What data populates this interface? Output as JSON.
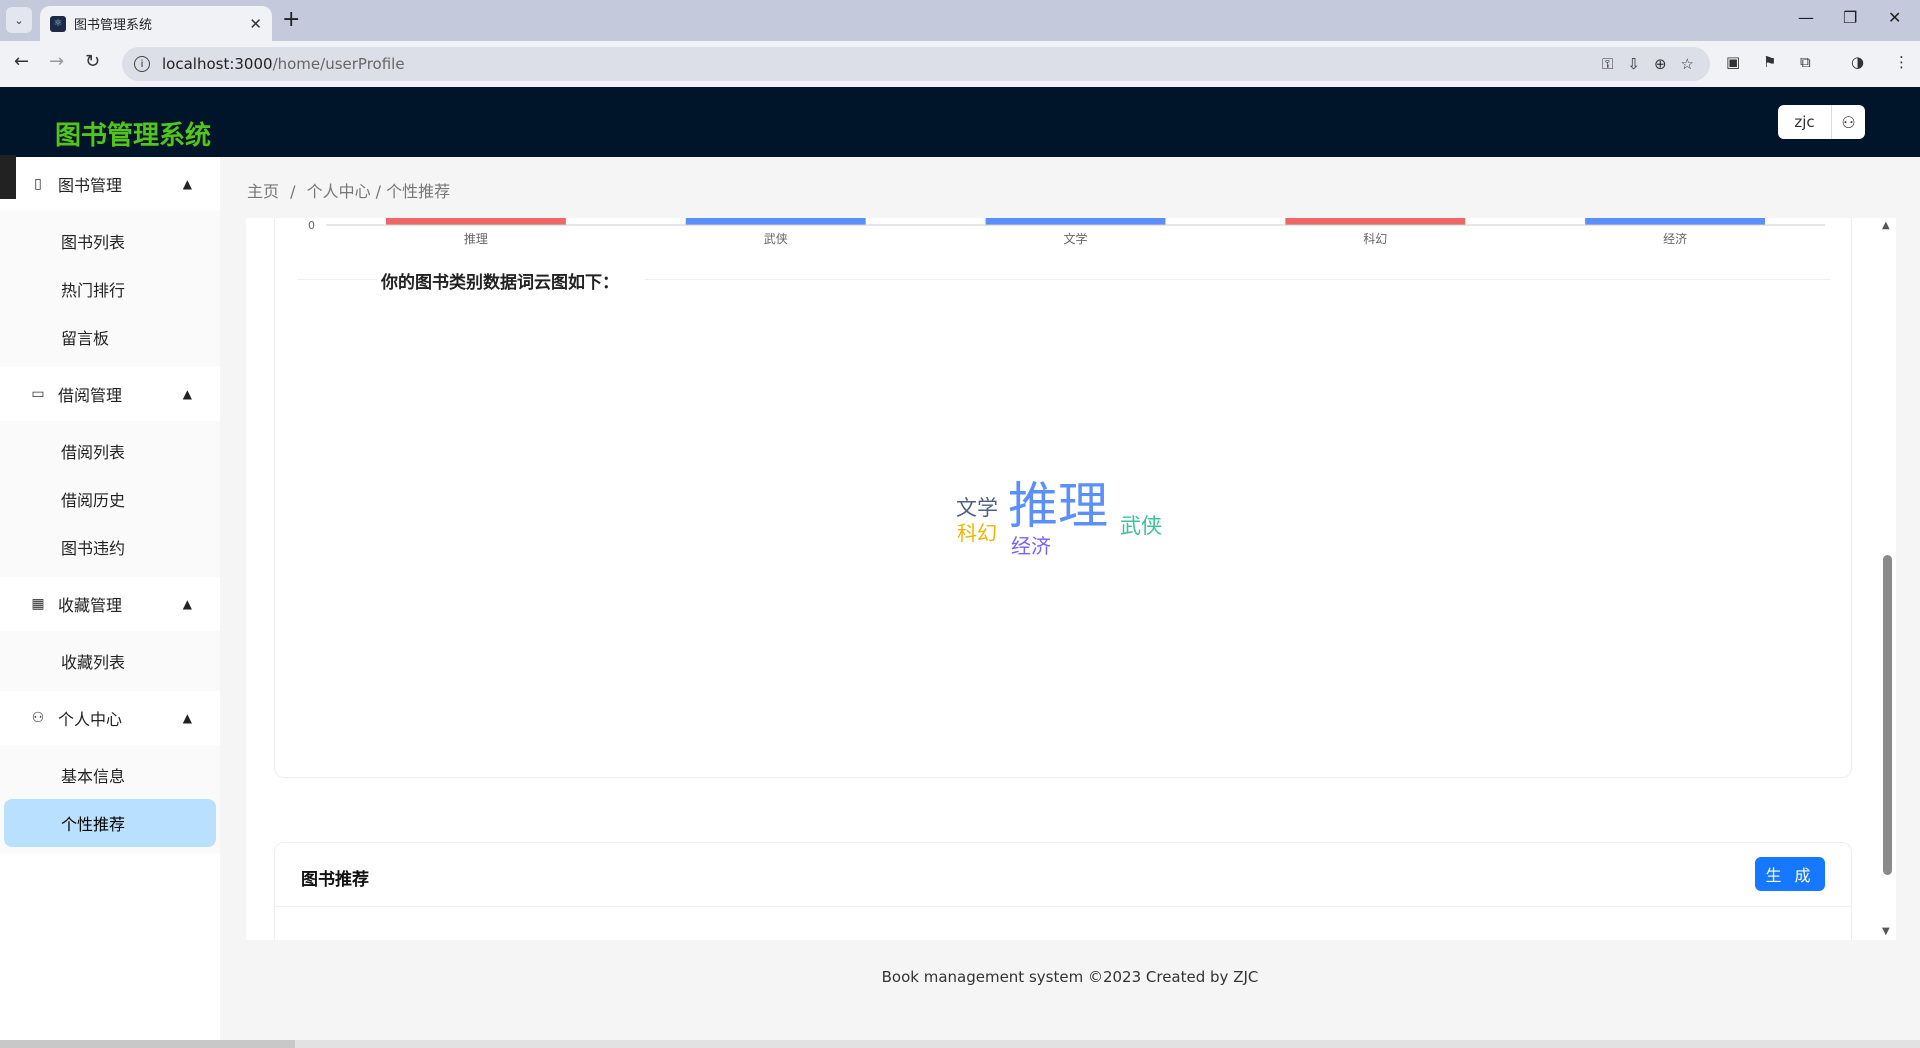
{
  "browser": {
    "tab_title": "图书管理系统",
    "url_host": "localhost:3000",
    "url_path": "/home/userProfile"
  },
  "header": {
    "logo": "图书管理系统",
    "username": "zjc"
  },
  "sidebar": {
    "groups": [
      {
        "label": "图书管理",
        "icon": "book-icon",
        "items": [
          "图书列表",
          "热门排行",
          "留言板"
        ]
      },
      {
        "label": "借阅管理",
        "icon": "laptop-icon",
        "items": [
          "借阅列表",
          "借阅历史",
          "图书违约"
        ]
      },
      {
        "label": "收藏管理",
        "icon": "grid-icon",
        "items": [
          "收藏列表"
        ]
      },
      {
        "label": "个人中心",
        "icon": "user-icon",
        "items": [
          "基本信息",
          "个性推荐"
        ]
      }
    ],
    "active_item": "个性推荐"
  },
  "breadcrumb": [
    "主页",
    "/",
    "个人中心 / 个性推荐"
  ],
  "chart_data": {
    "type": "bar",
    "categories": [
      "推理",
      "武侠",
      "文学",
      "科幻",
      "经济"
    ],
    "visible_tick": "0",
    "bar_colors": [
      "#ee6666",
      "#5b8ff9",
      "#5b8ff9",
      "#ee6666",
      "#5b8ff9"
    ]
  },
  "wordcloud": {
    "heading": "你的图书类别数据词云图如下：",
    "words": [
      {
        "text": "推理",
        "color": "#5b8ff9"
      },
      {
        "text": "文学",
        "color": "#4e5f86"
      },
      {
        "text": "科幻",
        "color": "#f0b400"
      },
      {
        "text": "武侠",
        "color": "#3cc29a"
      },
      {
        "text": "经济",
        "color": "#7b61ff"
      }
    ]
  },
  "recommend": {
    "title": "图书推荐",
    "button": "生 成"
  },
  "footer": "Book management system ©2023 Created by ZJC"
}
